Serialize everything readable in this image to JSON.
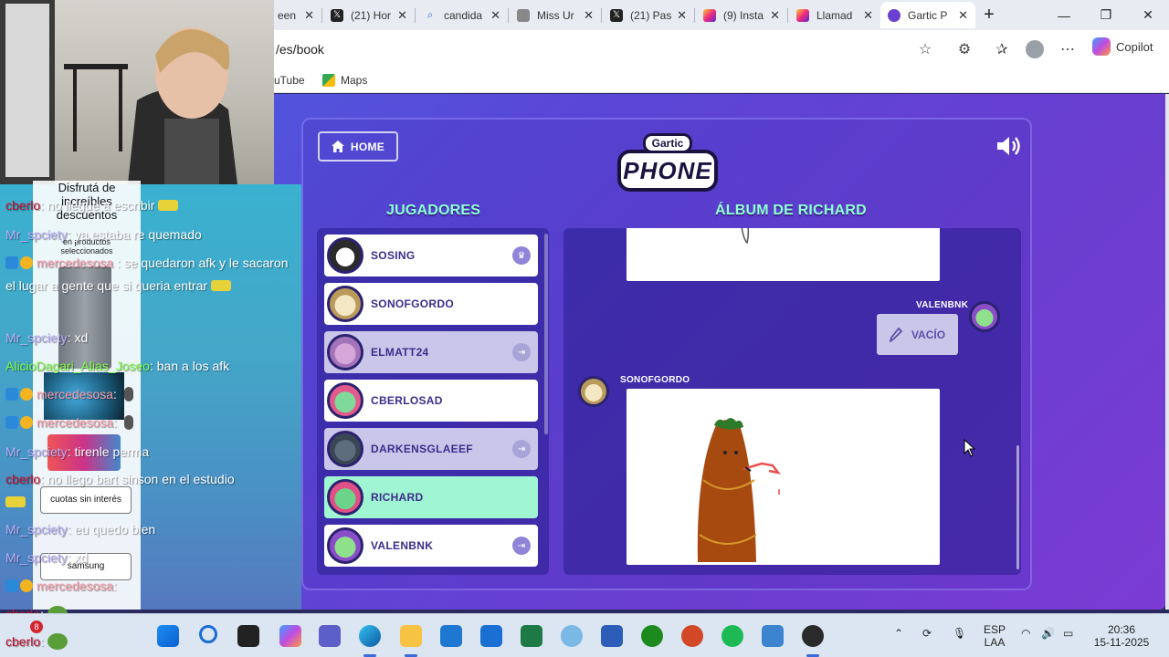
{
  "browser": {
    "tabs": [
      {
        "label": "een",
        "icon": "page-icon",
        "active": false
      },
      {
        "label": "(21) Hor",
        "icon": "x-icon",
        "active": false
      },
      {
        "label": "candida",
        "icon": "search-icon",
        "active": false
      },
      {
        "label": "Miss Ur",
        "icon": "page-icon",
        "active": false
      },
      {
        "label": "(21) Pas",
        "icon": "x-icon",
        "active": false
      },
      {
        "label": "(9) Insta",
        "icon": "instagram-icon",
        "active": false
      },
      {
        "label": "Llamad",
        "icon": "instagram-icon",
        "active": false
      },
      {
        "label": "Gartic P",
        "icon": "gartic-icon",
        "active": true
      }
    ],
    "url": "/es/book",
    "copilot_label": "Copilot",
    "bookmarks": [
      {
        "label": "uTube"
      },
      {
        "label": "Maps"
      }
    ]
  },
  "game": {
    "home_label": "HOME",
    "logo_top": "Gartic",
    "logo_bottom": "PHONE",
    "players_title": "JUGADORES",
    "album_title": "ÁLBUM DE RICHARD",
    "players": [
      {
        "name": "SOSING",
        "state": "normal",
        "badge": "crown-icon"
      },
      {
        "name": "SONOFGORDO",
        "state": "normal",
        "badge": ""
      },
      {
        "name": "ELMATT24",
        "state": "inactive",
        "badge": "exit-icon"
      },
      {
        "name": "CBERLOSAD",
        "state": "normal",
        "badge": ""
      },
      {
        "name": "DARKENSGLAEEF",
        "state": "inactive",
        "badge": "exit-icon"
      },
      {
        "name": "RICHARD",
        "state": "current",
        "badge": ""
      },
      {
        "name": "VALENBNK",
        "state": "normal",
        "badge": "exit-icon"
      }
    ],
    "album": {
      "entry_valenbnk_author": "VALENBNK",
      "entry_valenbnk_text": "VACÍO",
      "entry_sonofgordo_author": "SONOFGORDO"
    },
    "colors": {
      "accent_green": "#8dffcf",
      "current_player": "#a0f5d2",
      "inactive_player": "#c9c6ea",
      "ink": "#3b2d8c"
    }
  },
  "stream": {
    "ad": {
      "headline": "Disfrutá de increíbles descuentos",
      "sub": "en productos seleccionados",
      "btn_cuotas": "cuotas sin interés",
      "btn_samsung": "samsung"
    },
    "chat": [
      {
        "user": "cberlo",
        "text": ": no llegue a escribir",
        "emote": "glasses",
        "type": "cberlo"
      },
      {
        "user": "Mr_spciety",
        "text": ": ya estaba re quemado",
        "emote": "",
        "type": "mr"
      },
      {
        "user": "mercedesosa",
        "text": ": se quedaron afk y le sacaron el lugar a gente que si queria entrar",
        "emote": "glasses",
        "type": "merce"
      },
      {
        "user": "Mr_spciety",
        "text": ": xd",
        "emote": "",
        "type": "mr"
      },
      {
        "user": "AlicioDagari_Alias_Joseo",
        "text": ": ban a los afk",
        "emote": "",
        "type": "alicio"
      },
      {
        "user": "mercedesosa",
        "text": ":",
        "emote": "mic",
        "type": "merce"
      },
      {
        "user": "mercedesosa",
        "text": ":",
        "emote": "mic",
        "type": "merce"
      },
      {
        "user": "Mr_spciety",
        "text": ": tirenle perma",
        "emote": "",
        "type": "mr"
      },
      {
        "user": "cberlo",
        "text": ": no llego bart sinson en el estudio",
        "emote": "glasses",
        "type": "cberlo"
      },
      {
        "user": "Mr_spciety",
        "text": ": eu quedo bien",
        "emote": "",
        "type": "mr"
      },
      {
        "user": "Mr_spciety",
        "text": ": xd",
        "emote": "",
        "type": "mr"
      },
      {
        "user": "mercedesosa",
        "text": ":",
        "emote": "",
        "type": "merce"
      },
      {
        "user": "cberlo",
        "text": ":",
        "emote": "pepe",
        "type": "cberlo"
      },
      {
        "user": "cberlo",
        "text": ":",
        "emote": "pepe",
        "type": "cberlo"
      }
    ],
    "notification_count": "8"
  },
  "taskbar": {
    "lang_top": "ESP",
    "lang_bottom": "LAA",
    "time": "20:36",
    "date": "15-11-2025"
  }
}
